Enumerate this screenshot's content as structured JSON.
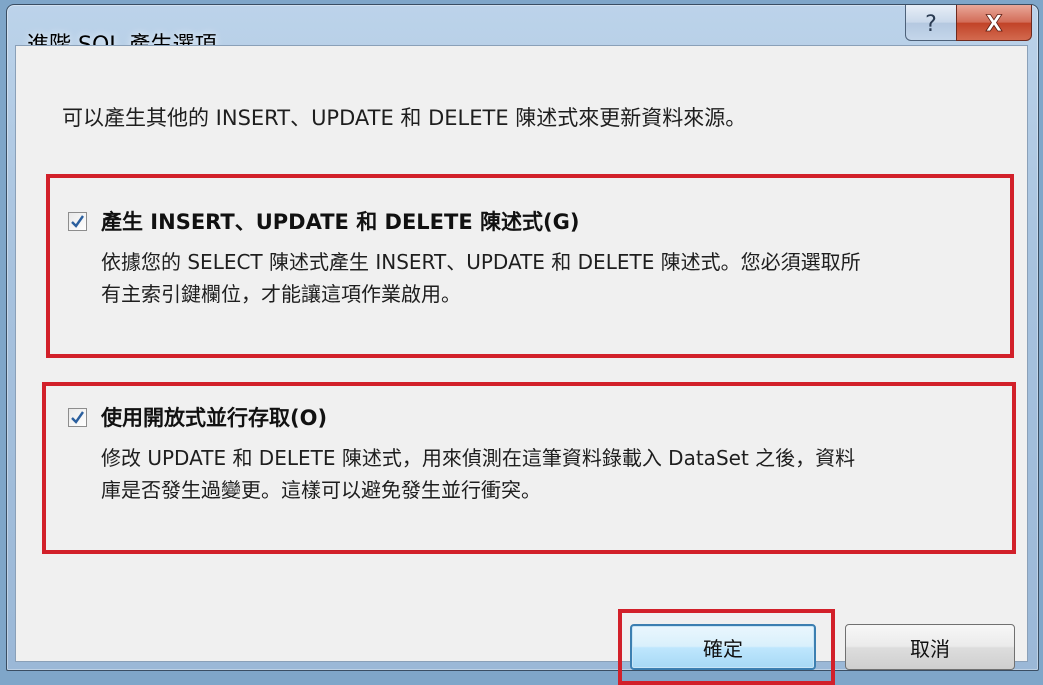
{
  "window": {
    "title": "進階 SQL 產生選項"
  },
  "titlebar": {
    "help_icon": "help-icon",
    "close_icon": "close-icon",
    "help_glyph": "?",
    "close_glyph": "X"
  },
  "intro_text": "可以產生其他的 INSERT、UPDATE 和 DELETE 陳述式來更新資料來源。",
  "options": [
    {
      "label": "產生 INSERT、UPDATE 和 DELETE 陳述式(G)",
      "checked": true,
      "description_line1": "依據您的 SELECT 陳述式產生 INSERT、UPDATE 和 DELETE 陳述式。您必須選取所",
      "description_line2": "有主索引鍵欄位，才能讓這項作業啟用。"
    },
    {
      "label": "使用開放式並行存取(O)",
      "checked": true,
      "description_line1": "修改 UPDATE 和 DELETE 陳述式，用來偵測在這筆資料錄載入 DataSet 之後，資料",
      "description_line2": "庫是否發生過變更。這樣可以避免發生並行衝突。"
    }
  ],
  "buttons": {
    "ok_label": "確定",
    "cancel_label": "取消"
  },
  "colors": {
    "highlight": "#d2202a",
    "check": "#2b5f9e"
  }
}
